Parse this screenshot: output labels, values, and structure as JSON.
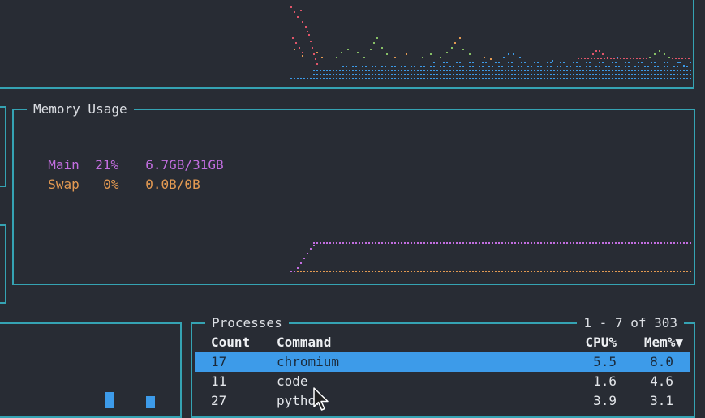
{
  "colors": {
    "background": "#282c34",
    "border": "#35a3b3",
    "main_memory": "#c26ee0",
    "swap_memory": "#e49a52",
    "selected_row": "#3d9be9",
    "graph_red": "#e0566a",
    "graph_green": "#87c066",
    "graph_orange": "#e49a52",
    "graph_blue": "#3d9be9"
  },
  "memory": {
    "title": "Memory Usage",
    "main": {
      "label": "Main",
      "percent": "21%",
      "amount": "6.7GB/31GB"
    },
    "swap": {
      "label": "Swap",
      "percent": "0%",
      "amount": "0.0B/0B"
    }
  },
  "processes": {
    "title": "Processes",
    "range": "1 - 7 of 303",
    "columns": {
      "count": "Count",
      "command": "Command",
      "cpu": "CPU%",
      "mem": "Mem%▼"
    },
    "rows": [
      {
        "count": "17",
        "command": "chromium",
        "cpu": "5.5",
        "mem": "8.0",
        "selected": true
      },
      {
        "count": "11",
        "command": "code",
        "cpu": "1.6",
        "mem": "4.6",
        "selected": false
      },
      {
        "count": "27",
        "command": "python",
        "cpu": "3.9",
        "mem": "3.1",
        "selected": false
      }
    ]
  },
  "icons": {
    "cursor": "mouse-pointer-icon"
  }
}
